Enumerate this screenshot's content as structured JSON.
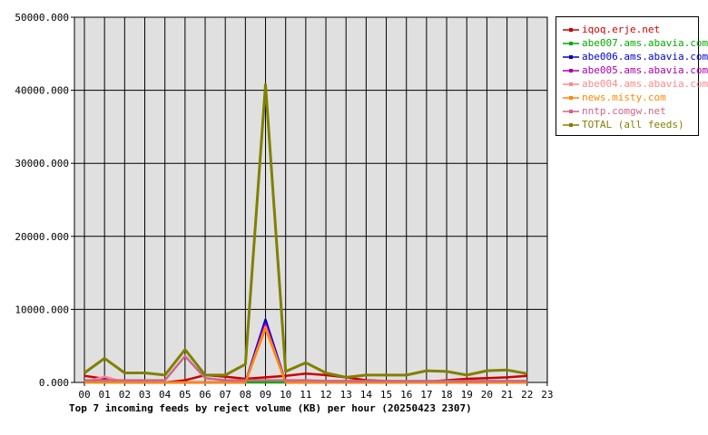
{
  "chart_data": {
    "type": "line",
    "title": "Top 7 incoming feeds by reject volume (KB) per hour (20250423 2307)",
    "xlabel": "",
    "ylabel": "",
    "categories": [
      "00",
      "01",
      "02",
      "03",
      "04",
      "05",
      "06",
      "07",
      "08",
      "09",
      "10",
      "11",
      "12",
      "13",
      "14",
      "15",
      "16",
      "17",
      "18",
      "19",
      "20",
      "21",
      "22",
      "23"
    ],
    "ylim": [
      0,
      50000
    ],
    "yticks": [
      "0.000",
      "10000.000",
      "20000.000",
      "30000.000",
      "40000.000",
      "50000.000"
    ],
    "grid": true,
    "legend_position": "right",
    "series": [
      {
        "name": "iqoq.erje.net",
        "color": "#cc0000",
        "values": [
          900,
          500,
          100,
          0,
          0,
          300,
          1000,
          800,
          500,
          700,
          900,
          1200,
          1000,
          700,
          300,
          200,
          100,
          100,
          300,
          500,
          600,
          700,
          900,
          null
        ]
      },
      {
        "name": "abe007.ams.abavia.com",
        "color": "#00aa00",
        "values": [
          0,
          0,
          0,
          0,
          0,
          0,
          0,
          0,
          0,
          0,
          0,
          0,
          0,
          0,
          0,
          0,
          0,
          0,
          0,
          0,
          0,
          0,
          0,
          null
        ]
      },
      {
        "name": "abe006.ams.abavia.com",
        "color": "#0000cc",
        "values": [
          0,
          500,
          0,
          0,
          0,
          0,
          0,
          0,
          0,
          8600,
          0,
          0,
          0,
          0,
          0,
          0,
          0,
          0,
          0,
          0,
          0,
          0,
          0,
          null
        ]
      },
      {
        "name": "abe005.ams.abavia.com",
        "color": "#aa00aa",
        "values": [
          0,
          700,
          0,
          0,
          0,
          0,
          0,
          0,
          0,
          8000,
          0,
          0,
          0,
          0,
          0,
          0,
          0,
          0,
          0,
          0,
          0,
          0,
          0,
          null
        ]
      },
      {
        "name": "abe004.ams.abavia.com",
        "color": "#ff8888",
        "values": [
          0,
          800,
          0,
          0,
          0,
          0,
          0,
          0,
          0,
          7600,
          0,
          0,
          0,
          0,
          0,
          0,
          0,
          0,
          0,
          0,
          0,
          0,
          0,
          null
        ]
      },
      {
        "name": "news.misty.com",
        "color": "#ff8800",
        "values": [
          0,
          0,
          0,
          0,
          0,
          0,
          0,
          0,
          0,
          7400,
          0,
          0,
          0,
          0,
          0,
          0,
          0,
          0,
          0,
          0,
          0,
          0,
          0,
          null
        ]
      },
      {
        "name": "nntp.comgw.net",
        "color": "#cc6688",
        "values": [
          300,
          300,
          300,
          300,
          300,
          3600,
          600,
          300,
          300,
          300,
          300,
          300,
          200,
          200,
          200,
          200,
          200,
          200,
          200,
          200,
          200,
          200,
          200,
          null
        ]
      },
      {
        "name": "TOTAL (all feeds)",
        "color": "#808000",
        "values": [
          1300,
          3300,
          1300,
          1300,
          1000,
          4500,
          1000,
          1000,
          2500,
          40800,
          1500,
          2700,
          1300,
          700,
          1000,
          1000,
          1000,
          1600,
          1500,
          1000,
          1600,
          1700,
          1200,
          null
        ]
      }
    ]
  }
}
